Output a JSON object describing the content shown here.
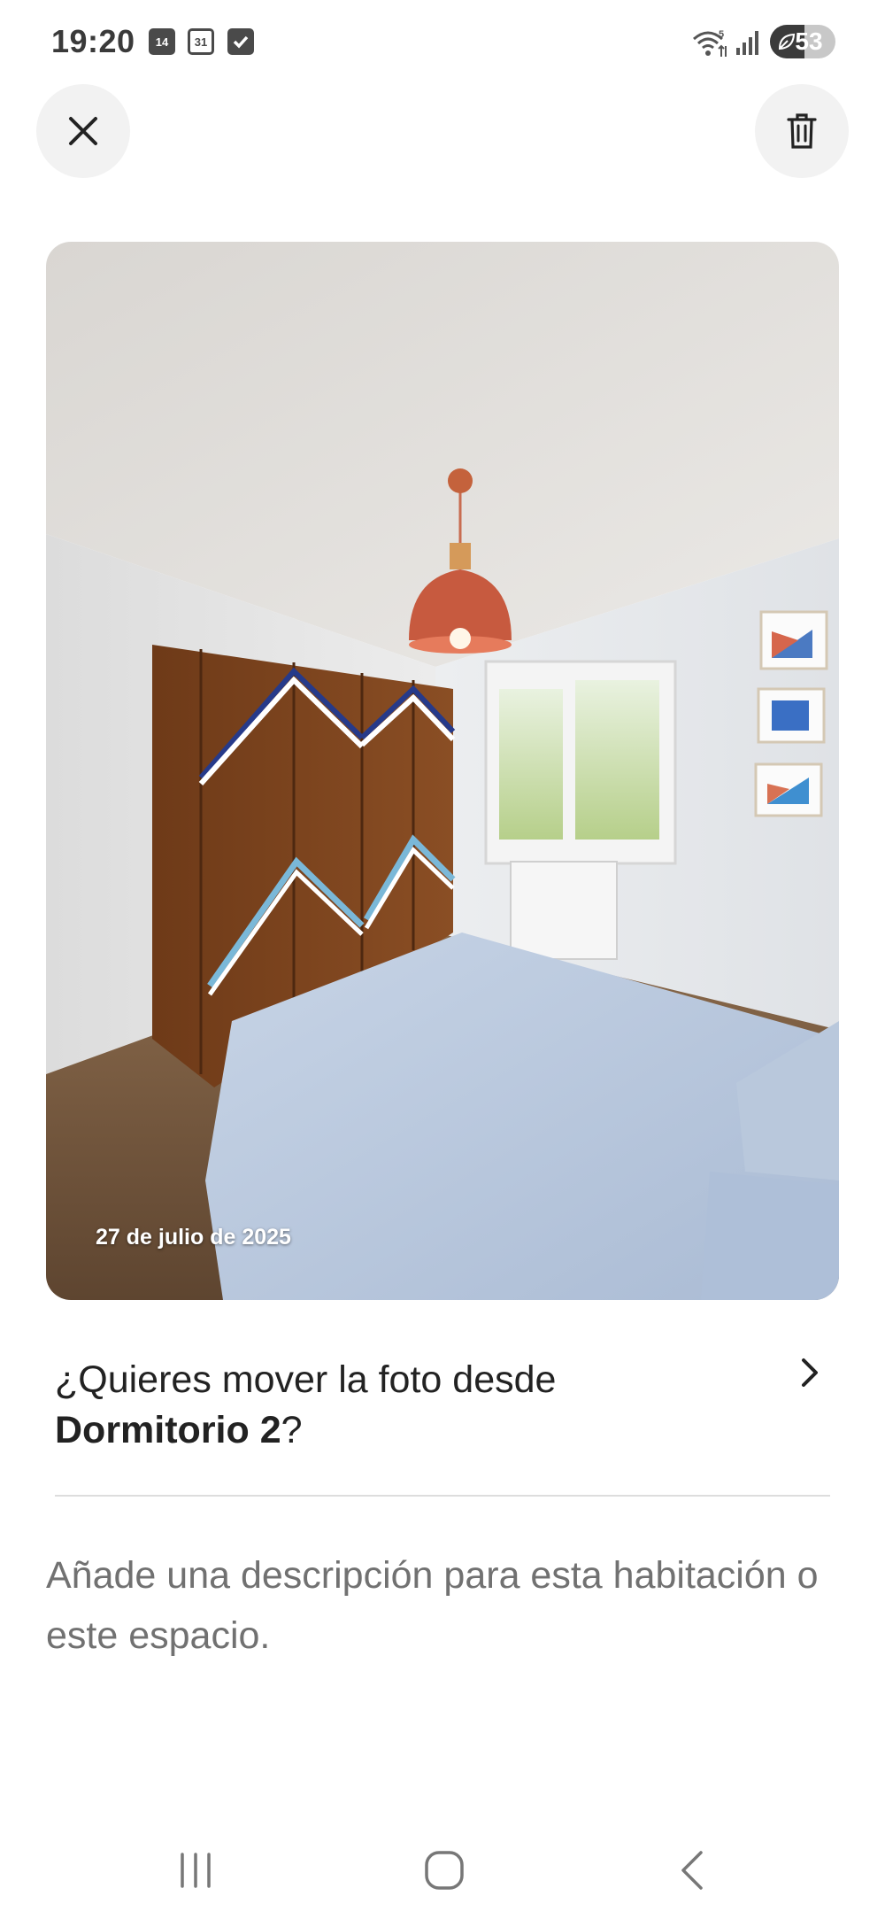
{
  "status_bar": {
    "time": "19:20",
    "calendar_badge_1": "14",
    "calendar_badge_2": "31",
    "battery_level": "53",
    "icons": [
      "calendar-icon",
      "calendar-icon",
      "checkbox-icon",
      "wifi-icon",
      "signal-icon",
      "battery-icon"
    ]
  },
  "header": {
    "close_icon": "close-icon",
    "delete_icon": "trash-icon"
  },
  "photo": {
    "date": "27 de julio de 2025"
  },
  "move": {
    "prefix": "¿Quieres mover la foto desde",
    "room": "Dormitorio 2",
    "suffix": "?"
  },
  "description": {
    "placeholder": "Añade una descripción para esta habitación o este espacio."
  },
  "nav": {
    "icons": [
      "recent-apps-icon",
      "home-icon",
      "back-icon"
    ]
  },
  "colors": {
    "accent": "#222222",
    "muted": "#717171",
    "button_bg": "#f2f2f2"
  }
}
